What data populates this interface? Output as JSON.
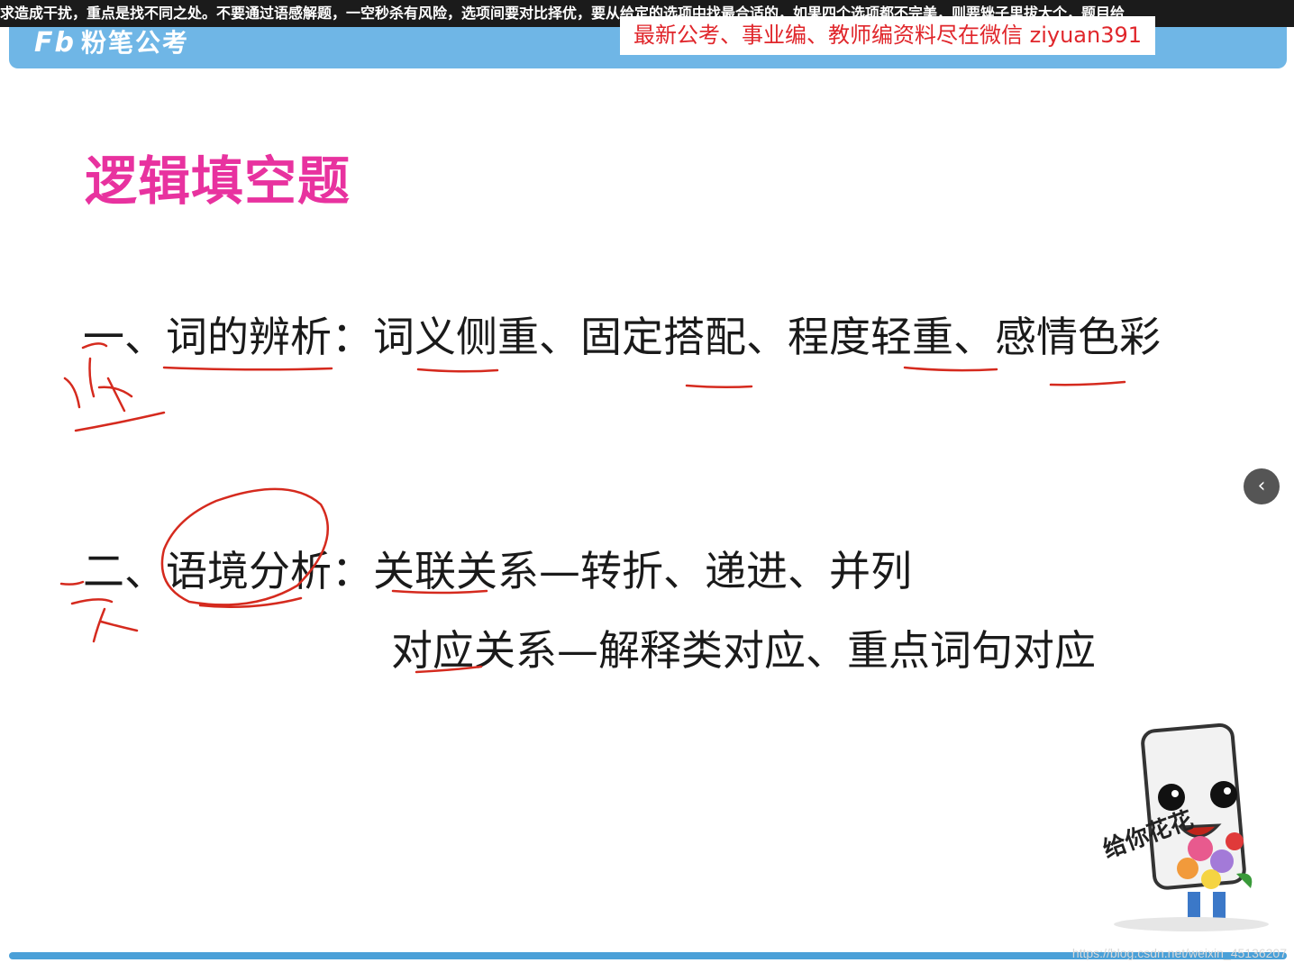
{
  "ticker": {
    "text": "求造成干扰，重点是找不同之处。不要通过语感解题，一空秒杀有风险，选项间要对比择优，要从给定的选项中找最合适的，如果四个选项都不完美，则要矬子里拔大个，题目给"
  },
  "header": {
    "logo_mark": "Fb",
    "logo_text": "粉笔公考",
    "promo": "最新公考、事业编、教师编资料尽在微信  ziyuan391"
  },
  "slide": {
    "title": "逻辑填空题",
    "line1": "一、词的辨析：词义侧重、固定搭配、程度轻重、感情色彩",
    "line2": "二、语境分析：关联关系—转折、递进、并列",
    "line3": "对应关系—解释类对应、重点词句对应"
  },
  "mascot": {
    "caption": "给你花花"
  },
  "nav": {
    "prev_label": "‹"
  },
  "watermark": "https://blog.csdn.net/weixin_45136207"
}
